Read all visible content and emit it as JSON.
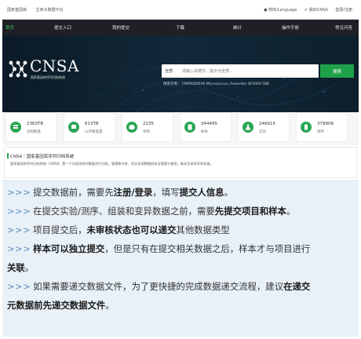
{
  "util_bar": {
    "links": [
      "国家基因库",
      "生命大数据平台"
    ],
    "language": "● 简体/Language",
    "help": "✔ 我的CNSA",
    "login": "登录/注册"
  },
  "nav": {
    "items": [
      {
        "label": "首页",
        "active": true
      },
      {
        "label": "提交入口",
        "active": false
      },
      {
        "label": "我的提交",
        "active": false
      },
      {
        "label": "下载",
        "active": false
      },
      {
        "label": "统计",
        "active": false
      },
      {
        "label": "操作手册",
        "active": false
      },
      {
        "label": "常见问答",
        "active": false
      }
    ]
  },
  "hero": {
    "logo_text": "CNSA",
    "logo_subtitle": "国家基因库序列归档系统",
    "search_scope": "全部",
    "search_placeholder": "请输入关键字，提示为全部...",
    "search_button": "搜索",
    "search_hint": "搜索示例： CNP0000049  Micrococcus_rhaeseller  BGI000-588"
  },
  "stats": [
    {
      "icon": "storage-icon",
      "value": "2363TB",
      "label": "归档数量"
    },
    {
      "icon": "database-icon",
      "value": "613TB",
      "label": "公开数据量"
    },
    {
      "icon": "project-icon",
      "value": "2235",
      "label": "项目"
    },
    {
      "icon": "sample-icon",
      "value": "344495",
      "label": "样本"
    },
    {
      "icon": "experiment-icon",
      "value": "246615",
      "label": "实验"
    },
    {
      "icon": "run-icon",
      "value": "379908",
      "label": "测序"
    }
  ],
  "intro": {
    "title": "CNSA｜国家基因库序列归档系统",
    "text": "国家基因库序列归档系统（CNSA）是一个对组学研究数据进行归档、管理和共享，旨在实现数据的安全管理与使用，推动生命科学的发展。"
  },
  "notes": [
    {
      "arrow": ">>>",
      "parts": [
        {
          "t": "提交数据前，需要先",
          "b": false
        },
        {
          "t": "注册/登录",
          "b": true
        },
        {
          "t": "，填写",
          "b": false
        },
        {
          "t": "提交人信息",
          "b": true
        },
        {
          "t": "。",
          "b": false
        }
      ]
    },
    {
      "arrow": ">>>",
      "parts": [
        {
          "t": "在提交实验/测序、组装和变异数据之前，需要",
          "b": false
        },
        {
          "t": "先提交项目和样本",
          "b": true
        },
        {
          "t": "。",
          "b": false
        }
      ]
    },
    {
      "arrow": ">>>",
      "parts": [
        {
          "t": "项目提交后，",
          "b": false
        },
        {
          "t": "未审核状态也可以递交",
          "b": true
        },
        {
          "t": "其他数据类型",
          "b": false
        }
      ]
    },
    {
      "arrow": ">>>",
      "parts": [
        {
          "t": "样本可以独立提交",
          "b": true
        },
        {
          "t": "，但是只有在提交相关数据之后，样本才与项目进行",
          "b": false
        }
      ]
    },
    {
      "arrow": "",
      "parts": [
        {
          "t": "关联",
          "b": true
        },
        {
          "t": "。",
          "b": false
        }
      ]
    },
    {
      "arrow": ">>>",
      "parts": [
        {
          "t": "如果需要递交数据文件，为了更快捷的完成数据递交流程，建议",
          "b": false
        },
        {
          "t": "在递交",
          "b": true
        }
      ]
    },
    {
      "arrow": "",
      "parts": [
        {
          "t": "元数据前先递交数据文件",
          "b": true
        },
        {
          "t": "。",
          "b": false
        }
      ]
    }
  ],
  "colors": {
    "accent_green": "#1fa14a",
    "nav_bg": "#1f2026",
    "hero_bg": "#0d1f2d",
    "notes_bg": "#e8f1f8",
    "arrow_blue": "#5d8fbf"
  }
}
